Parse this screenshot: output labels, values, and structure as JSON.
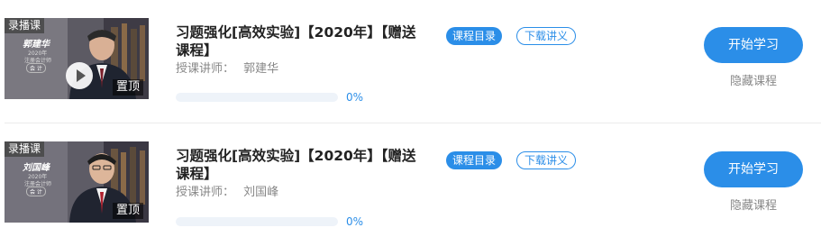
{
  "courses": [
    {
      "tag": "录播课",
      "pin": "置顶",
      "thumb_name": "郭建华",
      "thumb_year": "2020年",
      "thumb_sub": "注册会计师",
      "thumb_subject": "会 计",
      "title_line1": "习题强化[高效实验]【2020年】【赠送",
      "title_line2": "课程】",
      "teacher_label": "授课讲师：",
      "teacher_name": "郭建华",
      "catalog_label": "课程目录",
      "handout_label": "下载讲义",
      "progress_percent": 0,
      "progress_text": "0%",
      "start_label": "开始学习",
      "hide_label": "隐藏课程",
      "has_play": true
    },
    {
      "tag": "录播课",
      "pin": "置顶",
      "thumb_name": "刘国峰",
      "thumb_year": "2020年",
      "thumb_sub": "注册会计师",
      "thumb_subject": "会 计",
      "title_line1": "习题强化[高效实验]【2020年】【赠送",
      "title_line2": "课程】",
      "teacher_label": "授课讲师：",
      "teacher_name": "刘国峰",
      "catalog_label": "课程目录",
      "handout_label": "下载讲义",
      "progress_percent": 0,
      "progress_text": "0%",
      "start_label": "开始学习",
      "hide_label": "隐藏课程",
      "has_play": false
    }
  ],
  "colors": {
    "accent": "#2b8ee8",
    "muted_text": "#888888",
    "title_text": "#222222"
  }
}
